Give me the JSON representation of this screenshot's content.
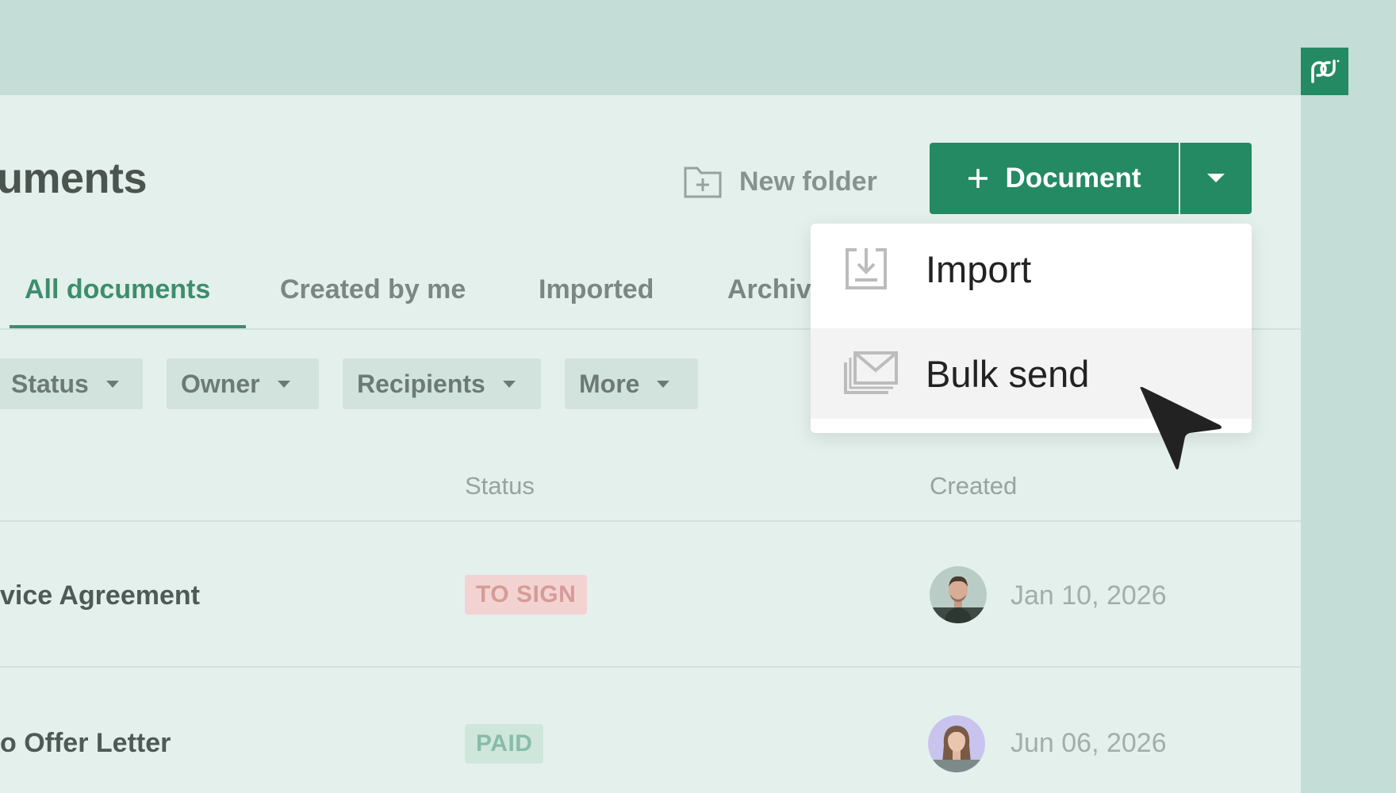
{
  "header": {
    "page_title": "uments",
    "new_folder_label": "New folder",
    "document_button_label": "Document"
  },
  "tabs": [
    {
      "label": "All documents",
      "active": true
    },
    {
      "label": "Created by me",
      "active": false
    },
    {
      "label": "Imported",
      "active": false
    },
    {
      "label": "Archiv",
      "active": false
    }
  ],
  "filters": [
    {
      "label": "Status"
    },
    {
      "label": "Owner"
    },
    {
      "label": "Recipients"
    },
    {
      "label": "More"
    }
  ],
  "table": {
    "columns": {
      "status": "Status",
      "created": "Created"
    },
    "rows": [
      {
        "title": "vice Agreement",
        "status": "TO SIGN",
        "status_kind": "to-sign",
        "created": "Jan 10, 2026",
        "avatar": "man-avatar"
      },
      {
        "title": "o Offer Letter",
        "status": "PAID",
        "status_kind": "paid",
        "created": "Jun 06, 2026",
        "avatar": "woman-avatar"
      }
    ]
  },
  "dropdown_menu": {
    "items": [
      {
        "label": "Import",
        "icon": "import-icon"
      },
      {
        "label": "Bulk send",
        "icon": "bulk-send-icon",
        "hovered": true
      }
    ]
  },
  "colors": {
    "brand_green": "#248a63",
    "active_tab": "#3e8d6d",
    "background": "#c4ddd6",
    "panel": "#e4f0ec"
  }
}
